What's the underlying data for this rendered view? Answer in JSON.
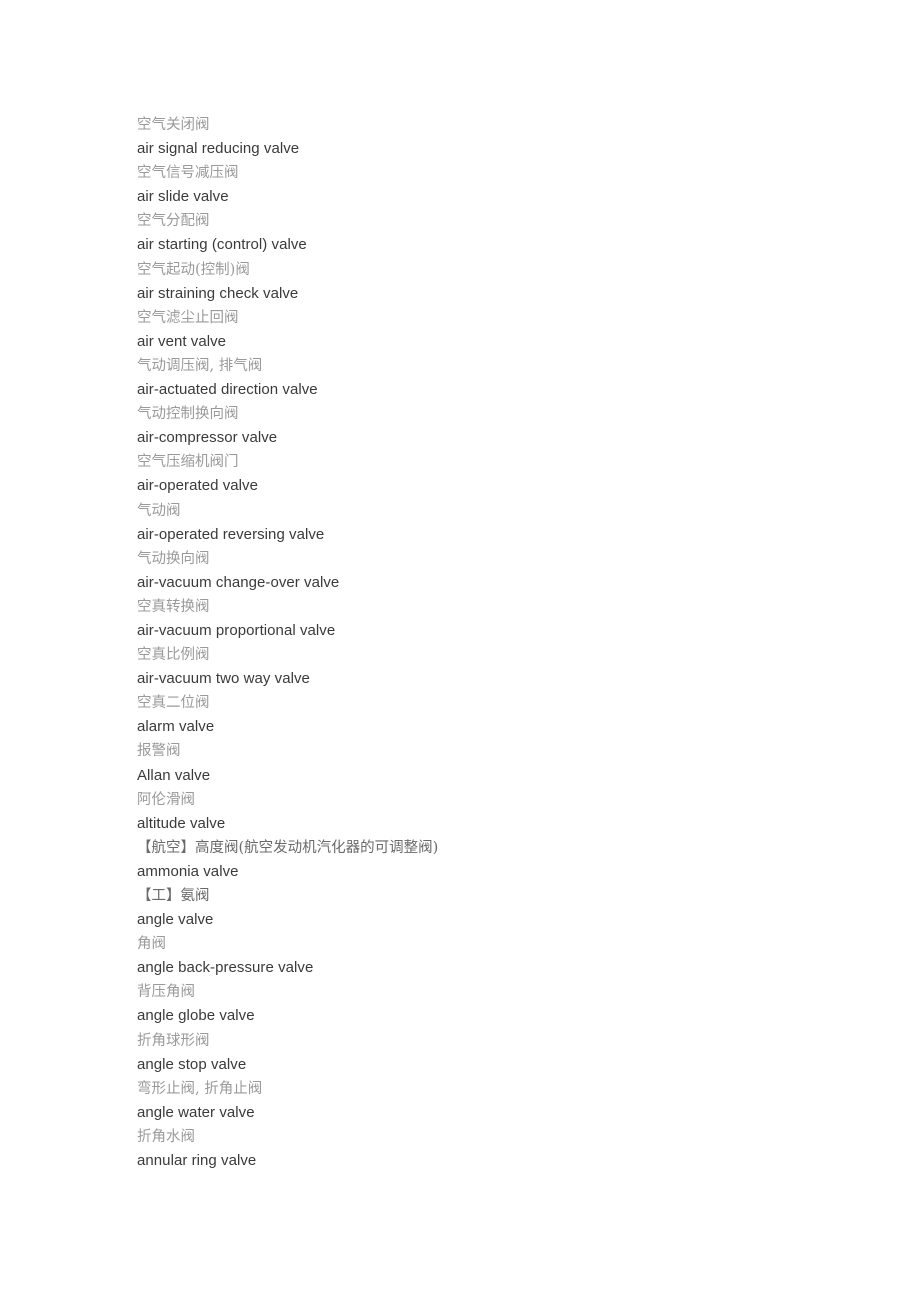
{
  "page": {
    "background_color": "#ffffff",
    "document_type": "bilingual-glossary",
    "english_color": "#3a3a3a",
    "chinese_color": "#9a9a9a",
    "chinese_marked_color": "#6a6a6a"
  },
  "entries": [
    {
      "lang": "zh",
      "text": "空气关闭阀",
      "marked": false
    },
    {
      "lang": "en",
      "text": "air signal reducing valve"
    },
    {
      "lang": "zh",
      "text": "空气信号减压阀",
      "marked": false
    },
    {
      "lang": "en",
      "text": "air slide valve"
    },
    {
      "lang": "zh",
      "text": "空气分配阀",
      "marked": false
    },
    {
      "lang": "en",
      "text": "air starting (control) valve"
    },
    {
      "lang": "zh",
      "text": "空气起动(控制)阀",
      "marked": false
    },
    {
      "lang": "en",
      "text": "air straining check valve"
    },
    {
      "lang": "zh",
      "text": "空气滤尘止回阀",
      "marked": false
    },
    {
      "lang": "en",
      "text": "air vent valve"
    },
    {
      "lang": "zh",
      "text": "气动调压阀, 排气阀",
      "marked": false
    },
    {
      "lang": "en",
      "text": "air-actuated direction valve"
    },
    {
      "lang": "zh",
      "text": "气动控制换向阀",
      "marked": false
    },
    {
      "lang": "en",
      "text": "air-compressor valve"
    },
    {
      "lang": "zh",
      "text": "空气压缩机阀门",
      "marked": false
    },
    {
      "lang": "en",
      "text": "air-operated valve"
    },
    {
      "lang": "zh",
      "text": "气动阀",
      "marked": false
    },
    {
      "lang": "en",
      "text": "air-operated reversing valve"
    },
    {
      "lang": "zh",
      "text": "气动换向阀",
      "marked": false
    },
    {
      "lang": "en",
      "text": "air-vacuum change-over valve"
    },
    {
      "lang": "zh",
      "text": "空真转换阀",
      "marked": false
    },
    {
      "lang": "en",
      "text": "air-vacuum proportional valve"
    },
    {
      "lang": "zh",
      "text": "空真比例阀",
      "marked": false
    },
    {
      "lang": "en",
      "text": "air-vacuum two way valve"
    },
    {
      "lang": "zh",
      "text": "空真二位阀",
      "marked": false
    },
    {
      "lang": "en",
      "text": "alarm valve"
    },
    {
      "lang": "zh",
      "text": "报警阀",
      "marked": false
    },
    {
      "lang": "en",
      "text": "Allan valve"
    },
    {
      "lang": "zh",
      "text": "阿伦滑阀",
      "marked": false
    },
    {
      "lang": "en",
      "text": "altitude valve"
    },
    {
      "lang": "zh",
      "text": "【航空】高度阀(航空发动机汽化器的可调整阀)",
      "marked": true
    },
    {
      "lang": "en",
      "text": "ammonia valve"
    },
    {
      "lang": "zh",
      "text": "【工】氨阀",
      "marked": true
    },
    {
      "lang": "en",
      "text": "angle valve"
    },
    {
      "lang": "zh",
      "text": "角阀",
      "marked": false
    },
    {
      "lang": "en",
      "text": "angle back-pressure valve"
    },
    {
      "lang": "zh",
      "text": "背压角阀",
      "marked": false
    },
    {
      "lang": "en",
      "text": "angle globe valve"
    },
    {
      "lang": "zh",
      "text": "折角球形阀",
      "marked": false
    },
    {
      "lang": "en",
      "text": "angle stop valve"
    },
    {
      "lang": "zh",
      "text": "弯形止阀, 折角止阀",
      "marked": false
    },
    {
      "lang": "en",
      "text": "angle water valve"
    },
    {
      "lang": "zh",
      "text": "折角水阀",
      "marked": false
    },
    {
      "lang": "en",
      "text": "annular ring valve"
    }
  ]
}
